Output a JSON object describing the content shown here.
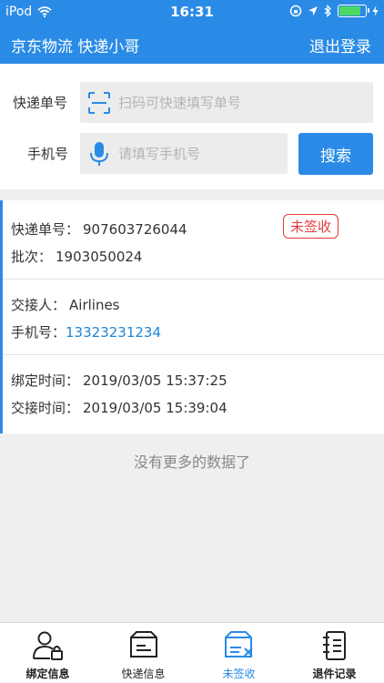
{
  "status_bar": {
    "carrier": "iPod",
    "time": "16:31"
  },
  "nav": {
    "title": "京东物流  快递小哥",
    "logout": "退出登录"
  },
  "search": {
    "tracking_label": "快递单号",
    "tracking_placeholder": "扫码可快速填写单号",
    "phone_label": "手机号",
    "phone_placeholder": "请填写手机号",
    "search_button": "搜索"
  },
  "record": {
    "tracking_label": "快递单号：",
    "tracking_no": "907603726044",
    "status": "未签收",
    "batch_label": "批次：",
    "batch": "1903050024",
    "handover_label": "交接人：",
    "handover": "Airlines",
    "phone_label": "手机号：",
    "phone": "13323231234",
    "bind_time_label": "绑定时间：",
    "bind_time": "2019/03/05 15:37:25",
    "handover_time_label": "交接时间：",
    "handover_time": "2019/03/05 15:39:04"
  },
  "empty_text": "没有更多的数据了",
  "tabs": [
    {
      "label": "绑定信息",
      "icon": "user-lock-icon"
    },
    {
      "label": "快递信息",
      "icon": "package-icon"
    },
    {
      "label": "未签收",
      "icon": "unsigned-package-icon"
    },
    {
      "label": "退件记录",
      "icon": "notebook-icon"
    }
  ],
  "colors": {
    "primary": "#2a8be6",
    "status_red": "#e23b3b",
    "link": "#1a85d6",
    "battery": "#4cd964"
  },
  "battery_level": 0.75
}
